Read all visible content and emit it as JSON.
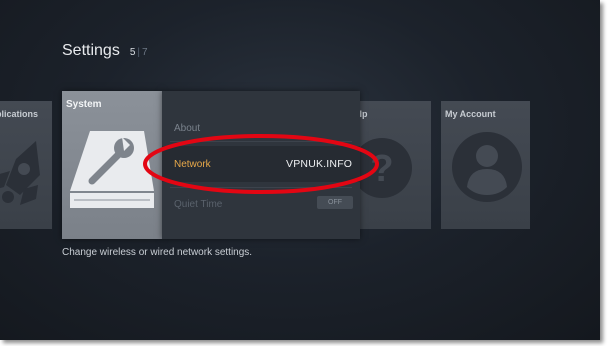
{
  "header": {
    "title": "Settings",
    "page_current": "5",
    "page_separator": "|",
    "page_total": "7"
  },
  "tiles": {
    "applications": {
      "label": "Applications",
      "icon": "rocket-icon"
    },
    "system": {
      "label": "System",
      "icon": "wrench-drive-icon"
    },
    "help": {
      "label": "Help",
      "icon": "question-icon"
    },
    "my_account": {
      "label": "My Account",
      "icon": "user-icon"
    }
  },
  "system_menu": {
    "about": "About",
    "network": "Network",
    "network_value": "VPNUK.INFO",
    "quiet_time": "Quiet Time",
    "quiet_time_toggle": "OFF"
  },
  "description": "Change wireless or wired network settings.",
  "colors": {
    "accent": "#e8a94a",
    "highlight_ring": "#e30613"
  }
}
